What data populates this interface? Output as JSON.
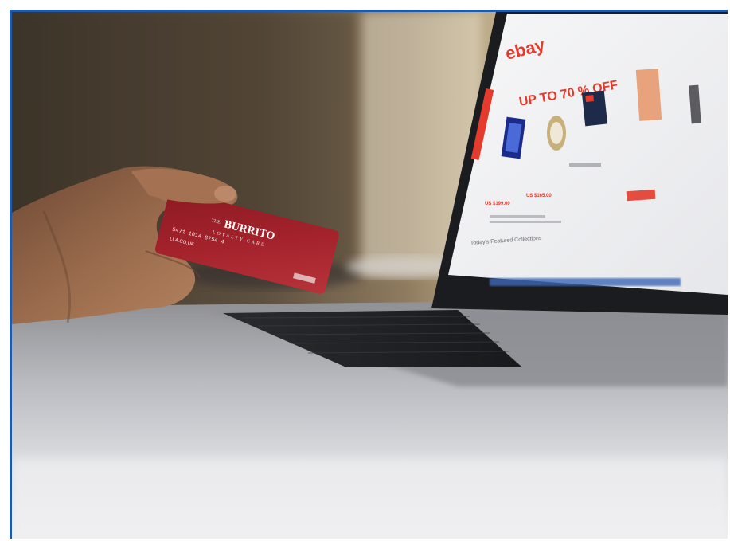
{
  "photo": {
    "alt": "Hand holding a red loyalty card in front of a laptop showing an online shopping page",
    "card": {
      "brand": "BURRITO",
      "brand_prefix": "THE",
      "subtitle": "LOYALTY CARD",
      "number": "5471 1014 8754 4",
      "url": "LLA.CO.UK"
    },
    "screen": {
      "logo": "ebay",
      "headline": "UP TO 70 % OFF",
      "section": "Today's Featured Collections",
      "price_1": "US $199.00",
      "price_2": "US $165.00"
    }
  },
  "colors": {
    "frame_border": "#1f5aa6",
    "card_red": "#a3222b",
    "sale_red": "#e43b2c"
  }
}
